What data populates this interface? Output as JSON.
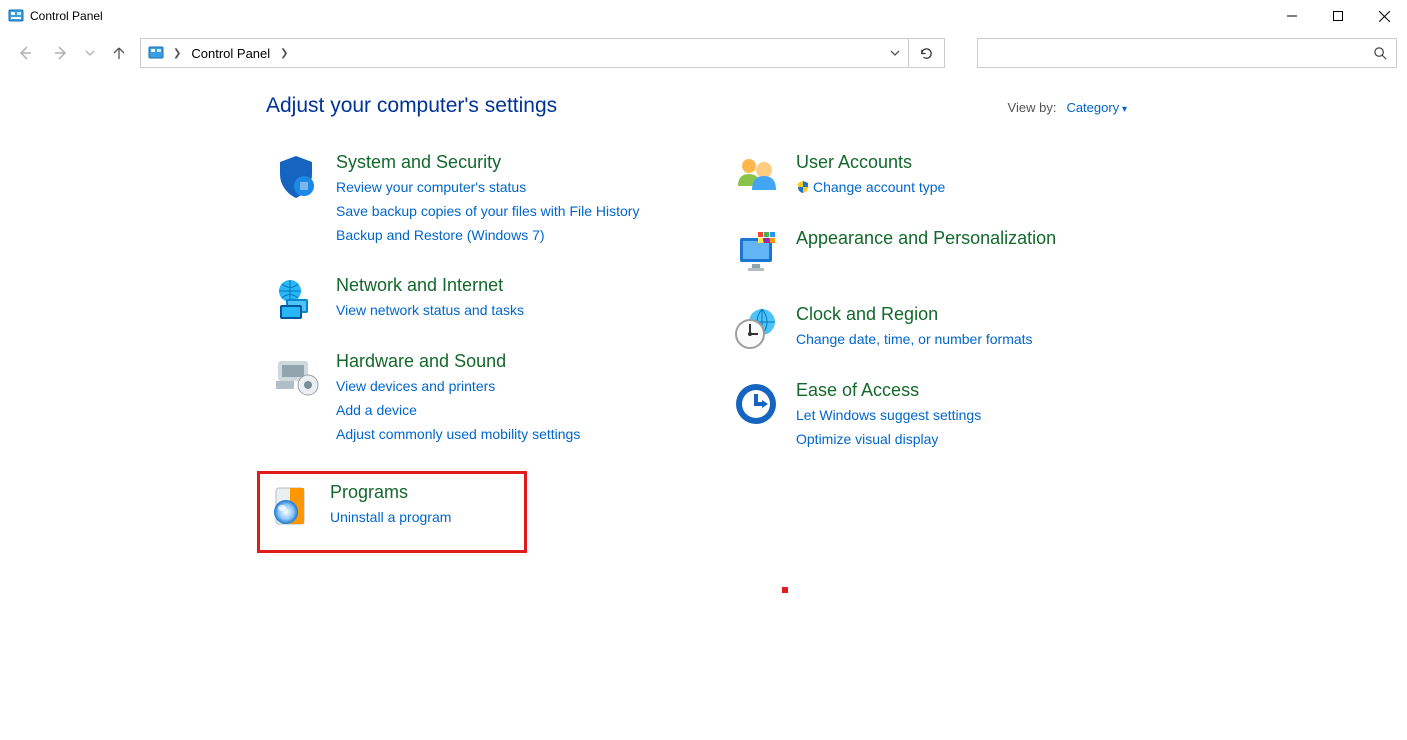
{
  "window": {
    "title": "Control Panel"
  },
  "breadcrumb": {
    "root": "Control Panel"
  },
  "page": {
    "heading": "Adjust your computer's settings",
    "viewby_label": "View by:",
    "viewby_value": "Category"
  },
  "left_categories": [
    {
      "id": "system-security",
      "title": "System and Security",
      "links": [
        "Review your computer's status",
        "Save backup copies of your files with File History",
        "Backup and Restore (Windows 7)"
      ]
    },
    {
      "id": "network-internet",
      "title": "Network and Internet",
      "links": [
        "View network status and tasks"
      ]
    },
    {
      "id": "hardware-sound",
      "title": "Hardware and Sound",
      "links": [
        "View devices and printers",
        "Add a device",
        "Adjust commonly used mobility settings"
      ]
    },
    {
      "id": "programs",
      "title": "Programs",
      "links": [
        "Uninstall a program"
      ],
      "highlighted": true
    }
  ],
  "right_categories": [
    {
      "id": "user-accounts",
      "title": "User Accounts",
      "links": [
        {
          "text": "Change account type",
          "shield": true
        }
      ]
    },
    {
      "id": "appearance",
      "title": "Appearance and Personalization",
      "links": []
    },
    {
      "id": "clock-region",
      "title": "Clock and Region",
      "links": [
        "Change date, time, or number formats"
      ]
    },
    {
      "id": "ease-access",
      "title": "Ease of Access",
      "links": [
        "Let Windows suggest settings",
        "Optimize visual display"
      ]
    }
  ]
}
